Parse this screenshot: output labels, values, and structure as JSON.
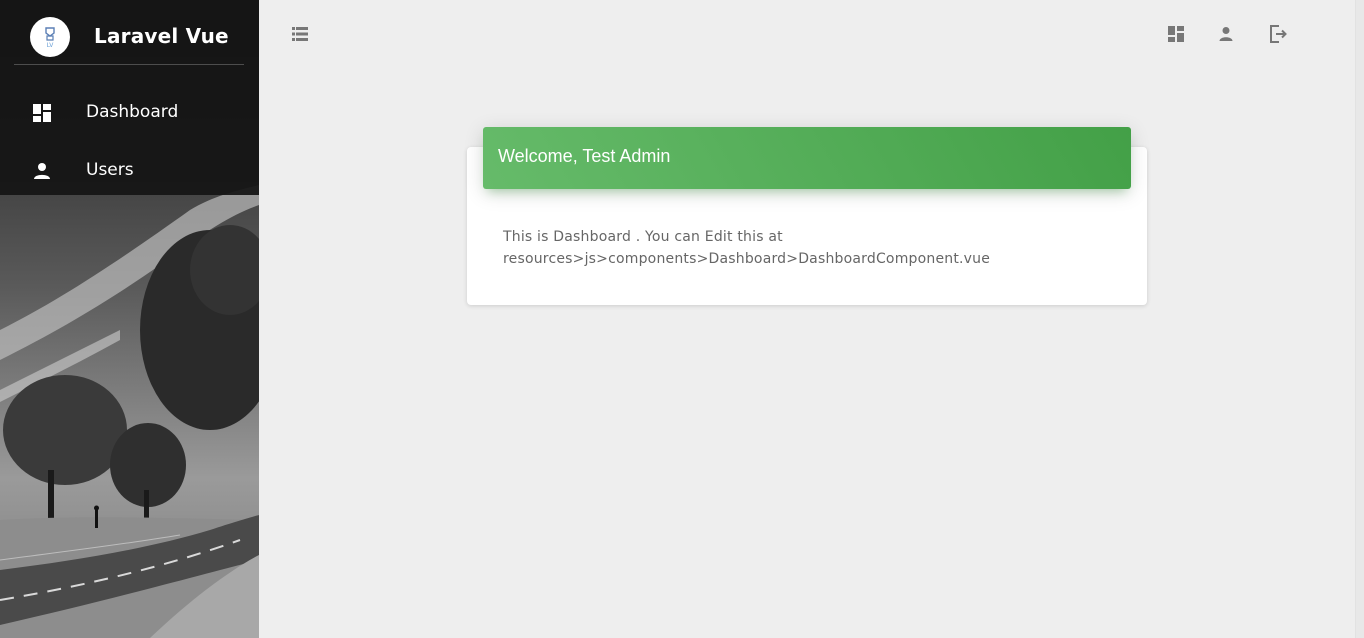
{
  "sidebar": {
    "brand": {
      "name": "Laravel Vue",
      "logo_icon": "laravel-vue-logo",
      "logo_text": "LV"
    },
    "items": [
      {
        "label": "Dashboard",
        "icon": "dashboard-icon"
      },
      {
        "label": "Users",
        "icon": "person-icon"
      }
    ]
  },
  "topbar": {
    "toggle_icon": "view-list-icon",
    "actions": [
      {
        "icon": "dashboard-icon"
      },
      {
        "icon": "person-icon"
      },
      {
        "icon": "logout-icon"
      }
    ]
  },
  "card": {
    "title": "Welcome, Test Admin",
    "body_line1": "This is Dashboard . You can Edit this at",
    "body_line2": "resources>js>components>Dashboard>DashboardComponent.vue"
  },
  "colors": {
    "sidebar_dark": "#141414",
    "header_green_start": "#66bb6a",
    "header_green_end": "#43a047",
    "page_bg": "#eeeeee",
    "icon_gray": "#777777"
  }
}
